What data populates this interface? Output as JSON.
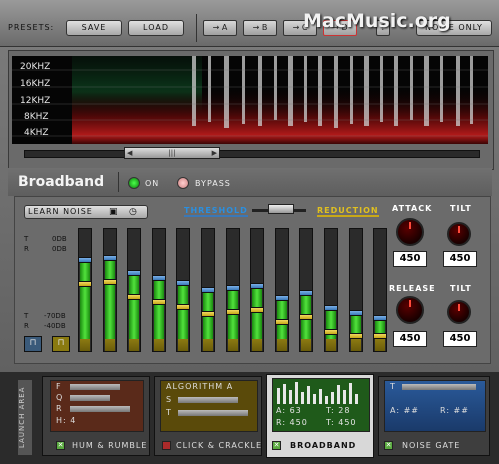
{
  "header": {
    "presets_label": "PRESETS:",
    "save_label": "SAVE",
    "load_label": "LOAD",
    "ab_buttons": [
      "→ A",
      "→ B",
      "→ C",
      "→ D"
    ],
    "question_label": "?",
    "noise_only_label": "NOISE ONLY",
    "watermark": "MacMusic.org"
  },
  "spectrogram": {
    "freq_labels": [
      "20KHZ",
      "16KHZ",
      "12KHZ",
      "8KHZ",
      "4KHZ"
    ],
    "scroll_grip": "|||"
  },
  "module": {
    "title": "Broadband",
    "on_label": "ON",
    "bypass_label": "BYPASS",
    "on_active": true,
    "bypass_active": false
  },
  "controls": {
    "learn_noise_label": "LEARN NOISE",
    "threshold_label": "THRESHOLD",
    "reduction_label": "REDUCTION",
    "t_top": "T",
    "t_top_val": "0DB",
    "r_top": "R",
    "r_top_val": "0DB",
    "t_bottom": "T",
    "t_bottom_val": "-70DB",
    "r_bottom": "R",
    "r_bottom_val": "-40DB",
    "attack_label": "ATTACK",
    "attack_value": "450",
    "tilt1_label": "TILT",
    "tilt1_value": "450",
    "release_label": "RELEASE",
    "release_value": "450",
    "tilt2_label": "TILT",
    "tilt2_value": "450",
    "accent_green": "#52e23c",
    "accent_yellow": "#c8a818",
    "accent_blue": "#3a78b8",
    "faders_green": [
      0.78,
      0.8,
      0.65,
      0.6,
      0.55,
      0.48,
      0.5,
      0.52,
      0.4,
      0.45,
      0.3,
      0.25,
      0.2
    ]
  },
  "launch": {
    "label": "LAUNCH AREA",
    "modules": [
      {
        "name": "HUM & RUMBLE",
        "lines": [
          "F",
          "Q",
          "R",
          "H: 4"
        ],
        "checked": true,
        "check_color": "#5aaa40"
      },
      {
        "name": "CLICK & CRACKLE",
        "lines": [
          "ALGORITHM A",
          "S",
          "T"
        ],
        "checked": false,
        "check_color": "#aa2a2a"
      },
      {
        "name": "BROADBAND",
        "lines": [
          "A: 63",
          "T: 28",
          "R: 450",
          "T: 450"
        ],
        "checked": true,
        "check_color": "#5aaa40"
      },
      {
        "name": "NOISE GATE",
        "lines": [
          "T",
          "A: ##",
          "R: ##"
        ],
        "checked": true,
        "check_color": "#5aaa40"
      }
    ]
  }
}
